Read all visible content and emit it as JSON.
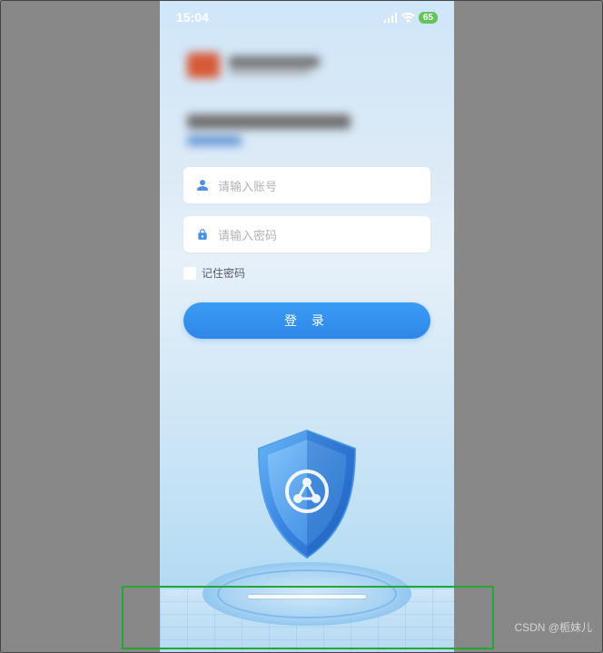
{
  "status": {
    "time": "15:04",
    "battery_pct": "65"
  },
  "form": {
    "account_placeholder": "请输入账号",
    "password_placeholder": "请输入密码",
    "remember_label": "记住密码",
    "login_label": "登 录"
  },
  "watermark": "CSDN @栀妹儿",
  "icons": {
    "user": "user-icon",
    "lock": "lock-icon",
    "signal": "signal-icon",
    "wifi": "wifi-icon",
    "shield": "shield-icon"
  }
}
